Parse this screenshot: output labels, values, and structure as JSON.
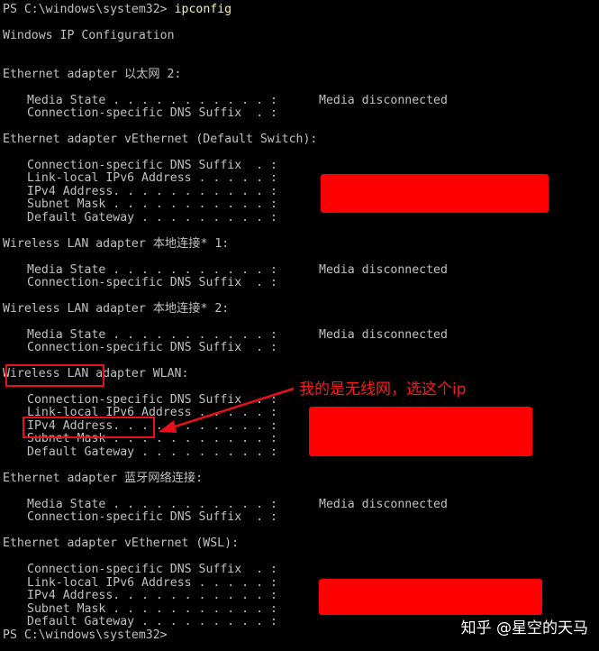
{
  "prompt": {
    "prefix": "PS C:\\windows\\system32> ",
    "command": "ipconfig"
  },
  "title": "Windows IP Configuration",
  "sections": [
    {
      "header": "Ethernet adapter 以太网 2:",
      "rows": [
        {
          "label": "Media State . . . . . . . . . . . :",
          "value": "Media disconnected"
        },
        {
          "label": "Connection-specific DNS Suffix  . :",
          "value": ""
        }
      ]
    },
    {
      "header": "Ethernet adapter vEthernet (Default Switch):",
      "rows": [
        {
          "label": "Connection-specific DNS Suffix  . :",
          "value": ""
        },
        {
          "label": "Link-local IPv6 Address . . . . . :",
          "value": ""
        },
        {
          "label": "IPv4 Address. . . . . . . . . . . :",
          "value": ""
        },
        {
          "label": "Subnet Mask . . . . . . . . . . . :",
          "value": ""
        },
        {
          "label": "Default Gateway . . . . . . . . . :",
          "value": ""
        }
      ]
    },
    {
      "header": "Wireless LAN adapter 本地连接* 1:",
      "rows": [
        {
          "label": "Media State . . . . . . . . . . . :",
          "value": "Media disconnected"
        },
        {
          "label": "Connection-specific DNS Suffix  . :",
          "value": ""
        }
      ]
    },
    {
      "header": "Wireless LAN adapter 本地连接* 2:",
      "rows": [
        {
          "label": "Media State . . . . . . . . . . . :",
          "value": "Media disconnected"
        },
        {
          "label": "Connection-specific DNS Suffix  . :",
          "value": ""
        }
      ]
    },
    {
      "header": "Wireless LAN adapter WLAN:",
      "rows": [
        {
          "label": "Connection-specific DNS Suffix  . :",
          "value": ""
        },
        {
          "label": "Link-local IPv6 Address . . . . . :",
          "value": ""
        },
        {
          "label": "IPv4 Address. . . . . . . . . . . :",
          "value": ""
        },
        {
          "label": "Subnet Mask . . . . . . . . . . . :",
          "value": ""
        },
        {
          "label": "Default Gateway . . . . . . . . . :",
          "value": ""
        }
      ]
    },
    {
      "header": "Ethernet adapter 蓝牙网络连接:",
      "rows": [
        {
          "label": "Media State . . . . . . . . . . . :",
          "value": "Media disconnected"
        },
        {
          "label": "Connection-specific DNS Suffix  . :",
          "value": ""
        }
      ]
    },
    {
      "header": "Ethernet adapter vEthernet (WSL):",
      "rows": [
        {
          "label": "Connection-specific DNS Suffix  . :",
          "value": ""
        },
        {
          "label": "Link-local IPv6 Address . . . . . :",
          "value": ""
        },
        {
          "label": "IPv4 Address. . . . . . . . . . . :",
          "value": ""
        },
        {
          "label": "Subnet Mask . . . . . . . . . . . :",
          "value": ""
        },
        {
          "label": "Default Gateway . . . . . . . . . :",
          "value": ""
        }
      ]
    }
  ],
  "final_prompt": "PS C:\\windows\\system32>",
  "annotation": "我的是无线网，选这个ip",
  "watermark": "知乎 @星空的天马",
  "colors": {
    "background": "#000000",
    "text": "#c0c0c0",
    "command": "#f9f1a5",
    "annotation": "#ff1a1a",
    "redaction": "#ff0000"
  }
}
